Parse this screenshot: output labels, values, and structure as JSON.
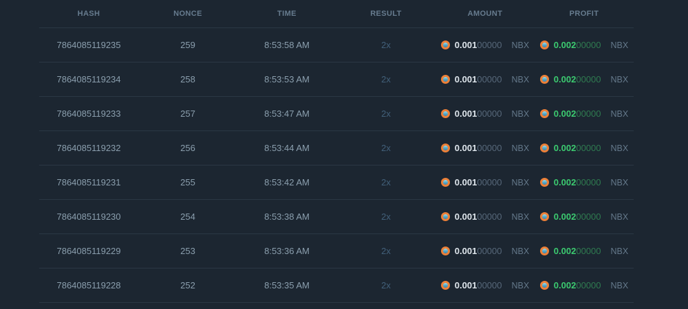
{
  "colors": {
    "bg": "#1c2631",
    "border": "#2b3844",
    "header-text": "#677c8f",
    "body-text": "#8b9fae",
    "result-text": "#42607a",
    "amount-main": "#dfe6ec",
    "zeros": "#57687a",
    "currency": "#64788a",
    "profit-main": "#3ccb70",
    "profit-zeros": "#2f7b50",
    "coin-outer": "#ec8038"
  },
  "icons": {
    "coin": "nbx-coin-icon"
  },
  "table": {
    "columns": [
      {
        "key": "hash",
        "label": "HASH"
      },
      {
        "key": "nonce",
        "label": "NONCE"
      },
      {
        "key": "time",
        "label": "TIME"
      },
      {
        "key": "result",
        "label": "RESULT"
      },
      {
        "key": "amount",
        "label": "AMOUNT"
      },
      {
        "key": "profit",
        "label": "PROFIT"
      }
    ],
    "rows": [
      {
        "hash": "7864085119235",
        "nonce": "259",
        "time": "8:53:58 AM",
        "result": "2x",
        "amount_main": "0.001",
        "amount_zeros": "00000",
        "amount_currency": "NBX",
        "profit_main": "0.002",
        "profit_zeros": "00000",
        "profit_currency": "NBX"
      },
      {
        "hash": "7864085119234",
        "nonce": "258",
        "time": "8:53:53 AM",
        "result": "2x",
        "amount_main": "0.001",
        "amount_zeros": "00000",
        "amount_currency": "NBX",
        "profit_main": "0.002",
        "profit_zeros": "00000",
        "profit_currency": "NBX"
      },
      {
        "hash": "7864085119233",
        "nonce": "257",
        "time": "8:53:47 AM",
        "result": "2x",
        "amount_main": "0.001",
        "amount_zeros": "00000",
        "amount_currency": "NBX",
        "profit_main": "0.002",
        "profit_zeros": "00000",
        "profit_currency": "NBX"
      },
      {
        "hash": "7864085119232",
        "nonce": "256",
        "time": "8:53:44 AM",
        "result": "2x",
        "amount_main": "0.001",
        "amount_zeros": "00000",
        "amount_currency": "NBX",
        "profit_main": "0.002",
        "profit_zeros": "00000",
        "profit_currency": "NBX"
      },
      {
        "hash": "7864085119231",
        "nonce": "255",
        "time": "8:53:42 AM",
        "result": "2x",
        "amount_main": "0.001",
        "amount_zeros": "00000",
        "amount_currency": "NBX",
        "profit_main": "0.002",
        "profit_zeros": "00000",
        "profit_currency": "NBX"
      },
      {
        "hash": "7864085119230",
        "nonce": "254",
        "time": "8:53:38 AM",
        "result": "2x",
        "amount_main": "0.001",
        "amount_zeros": "00000",
        "amount_currency": "NBX",
        "profit_main": "0.002",
        "profit_zeros": "00000",
        "profit_currency": "NBX"
      },
      {
        "hash": "7864085119229",
        "nonce": "253",
        "time": "8:53:36 AM",
        "result": "2x",
        "amount_main": "0.001",
        "amount_zeros": "00000",
        "amount_currency": "NBX",
        "profit_main": "0.002",
        "profit_zeros": "00000",
        "profit_currency": "NBX"
      },
      {
        "hash": "7864085119228",
        "nonce": "252",
        "time": "8:53:35 AM",
        "result": "2x",
        "amount_main": "0.001",
        "amount_zeros": "00000",
        "amount_currency": "NBX",
        "profit_main": "0.002",
        "profit_zeros": "00000",
        "profit_currency": "NBX"
      }
    ]
  }
}
